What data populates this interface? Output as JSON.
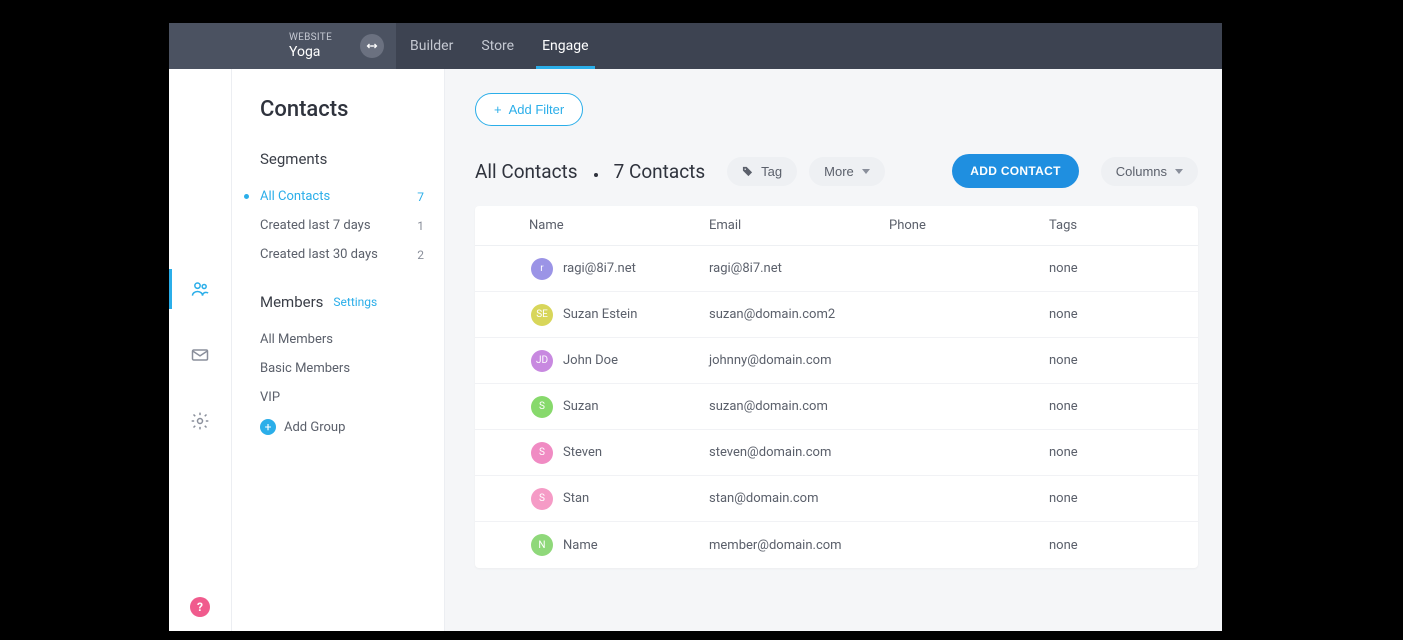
{
  "header": {
    "website_label": "WEBSITE",
    "website_name": "Yoga",
    "nav": [
      {
        "label": "Builder",
        "active": false
      },
      {
        "label": "Store",
        "active": false
      },
      {
        "label": "Engage",
        "active": true
      }
    ]
  },
  "sidebar": {
    "title": "Contacts",
    "segments_title": "Segments",
    "segments": [
      {
        "label": "All Contacts",
        "count": "7",
        "active": true
      },
      {
        "label": "Created last 7 days",
        "count": "1",
        "active": false
      },
      {
        "label": "Created last 30 days",
        "count": "2",
        "active": false
      }
    ],
    "members_title": "Members",
    "members_settings": "Settings",
    "members": [
      {
        "label": "All Members"
      },
      {
        "label": "Basic Members"
      },
      {
        "label": "VIP"
      }
    ],
    "add_group_label": "Add Group"
  },
  "main": {
    "add_filter_label": "Add Filter",
    "title": "All Contacts",
    "count_label": "7 Contacts",
    "tag_label": "Tag",
    "more_label": "More",
    "add_contact_label": "ADD CONTACT",
    "columns_label": "Columns",
    "columns": {
      "name": "Name",
      "email": "Email",
      "phone": "Phone",
      "tags": "Tags"
    },
    "rows": [
      {
        "initials": "r",
        "avatarColor": "#9b94e6",
        "name": "ragi@8i7.net",
        "email": "ragi@8i7.net",
        "phone": "",
        "tags": "none"
      },
      {
        "initials": "SE",
        "avatarColor": "#d8d65a",
        "name": "Suzan Estein",
        "email": "suzan@domain.com2",
        "phone": "",
        "tags": "none"
      },
      {
        "initials": "JD",
        "avatarColor": "#c889e0",
        "name": "John Doe",
        "email": "johnny@domain.com",
        "phone": "",
        "tags": "none"
      },
      {
        "initials": "S",
        "avatarColor": "#87d96c",
        "name": "Suzan",
        "email": "suzan@domain.com",
        "phone": "",
        "tags": "none"
      },
      {
        "initials": "S",
        "avatarColor": "#f08bc3",
        "name": "Steven",
        "email": "steven@domain.com",
        "phone": "",
        "tags": "none"
      },
      {
        "initials": "S",
        "avatarColor": "#f59bc6",
        "name": "Stan",
        "email": "stan@domain.com",
        "phone": "",
        "tags": "none"
      },
      {
        "initials": "N",
        "avatarColor": "#8fd87a",
        "name": "Name",
        "email": "member@domain.com",
        "phone": "",
        "tags": "none"
      }
    ]
  }
}
